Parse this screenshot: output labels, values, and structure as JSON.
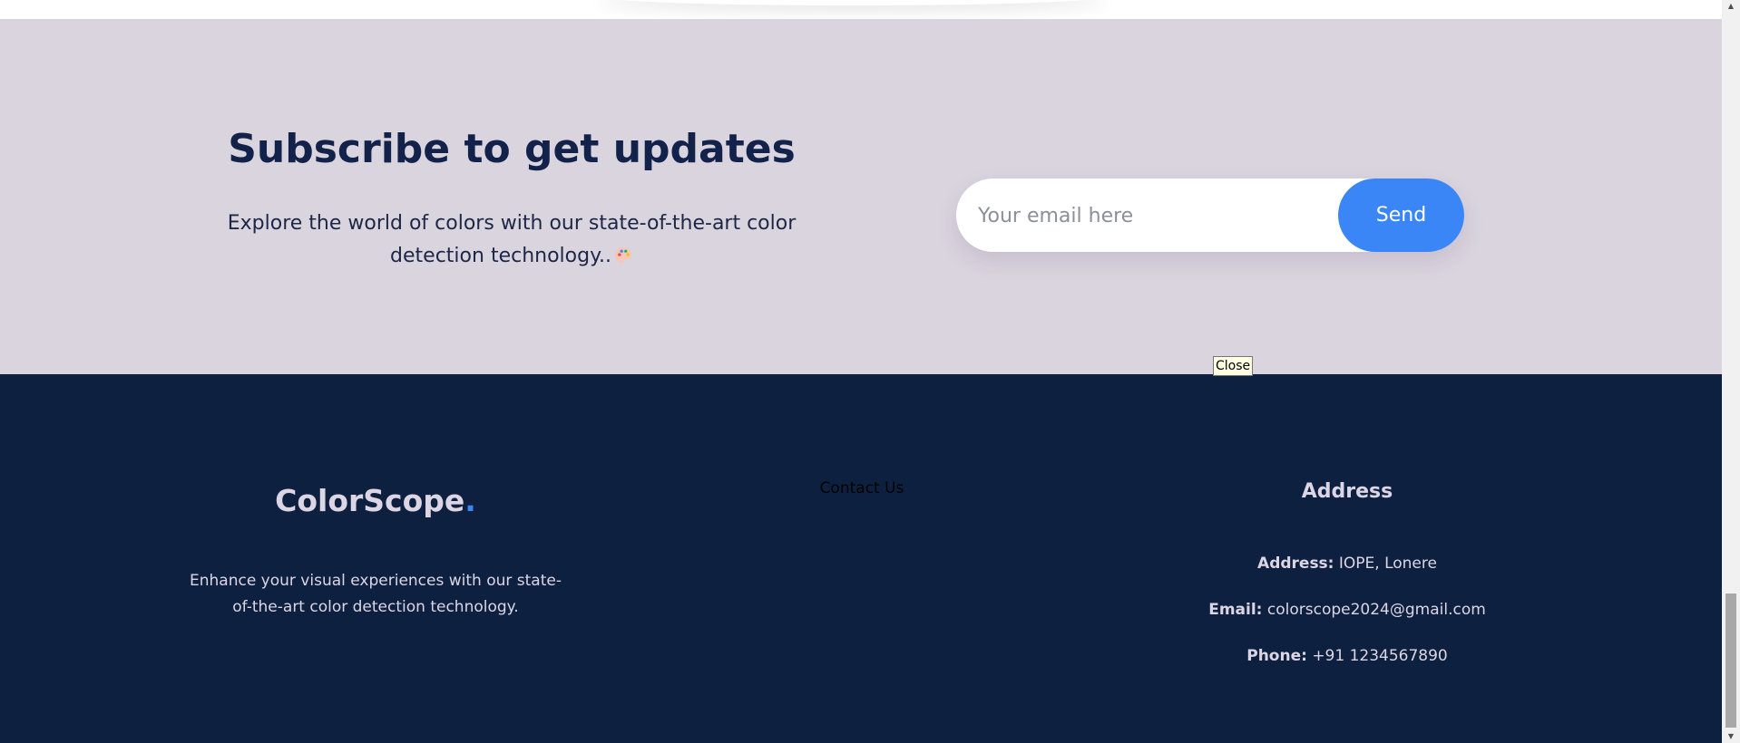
{
  "subscribe": {
    "title": "Subscribe to get updates",
    "description": "Explore the world of colors with our state-of-the-art color detection technology..",
    "emoji_icon": "palette-icon",
    "email_placeholder": "Your email here",
    "email_value": "",
    "send_label": "Send"
  },
  "tooltip": {
    "text": "Close"
  },
  "footer": {
    "brand_name": "ColorScope",
    "brand_dot": ".",
    "brand_description": "Enhance your visual experiences with our state-of-the-art color detection technology.",
    "contact_link": "Contact Us",
    "address_heading": "Address",
    "address_label": "Address:",
    "address_value": "IOPE, Lonere",
    "email_label": "Email:",
    "email_value": "colorscope2024@gmail.com",
    "phone_label": "Phone:",
    "phone_value": "+91 1234567890"
  },
  "colors": {
    "subscribe_bg": "#dad4de",
    "footer_bg": "#0e2040",
    "accent": "#3a86f7",
    "heading": "#13224a",
    "footer_text": "#dcd6e4"
  },
  "scrollbar": {
    "up_icon": "scroll-up-arrow-icon",
    "down_icon": "scroll-down-arrow-icon"
  }
}
